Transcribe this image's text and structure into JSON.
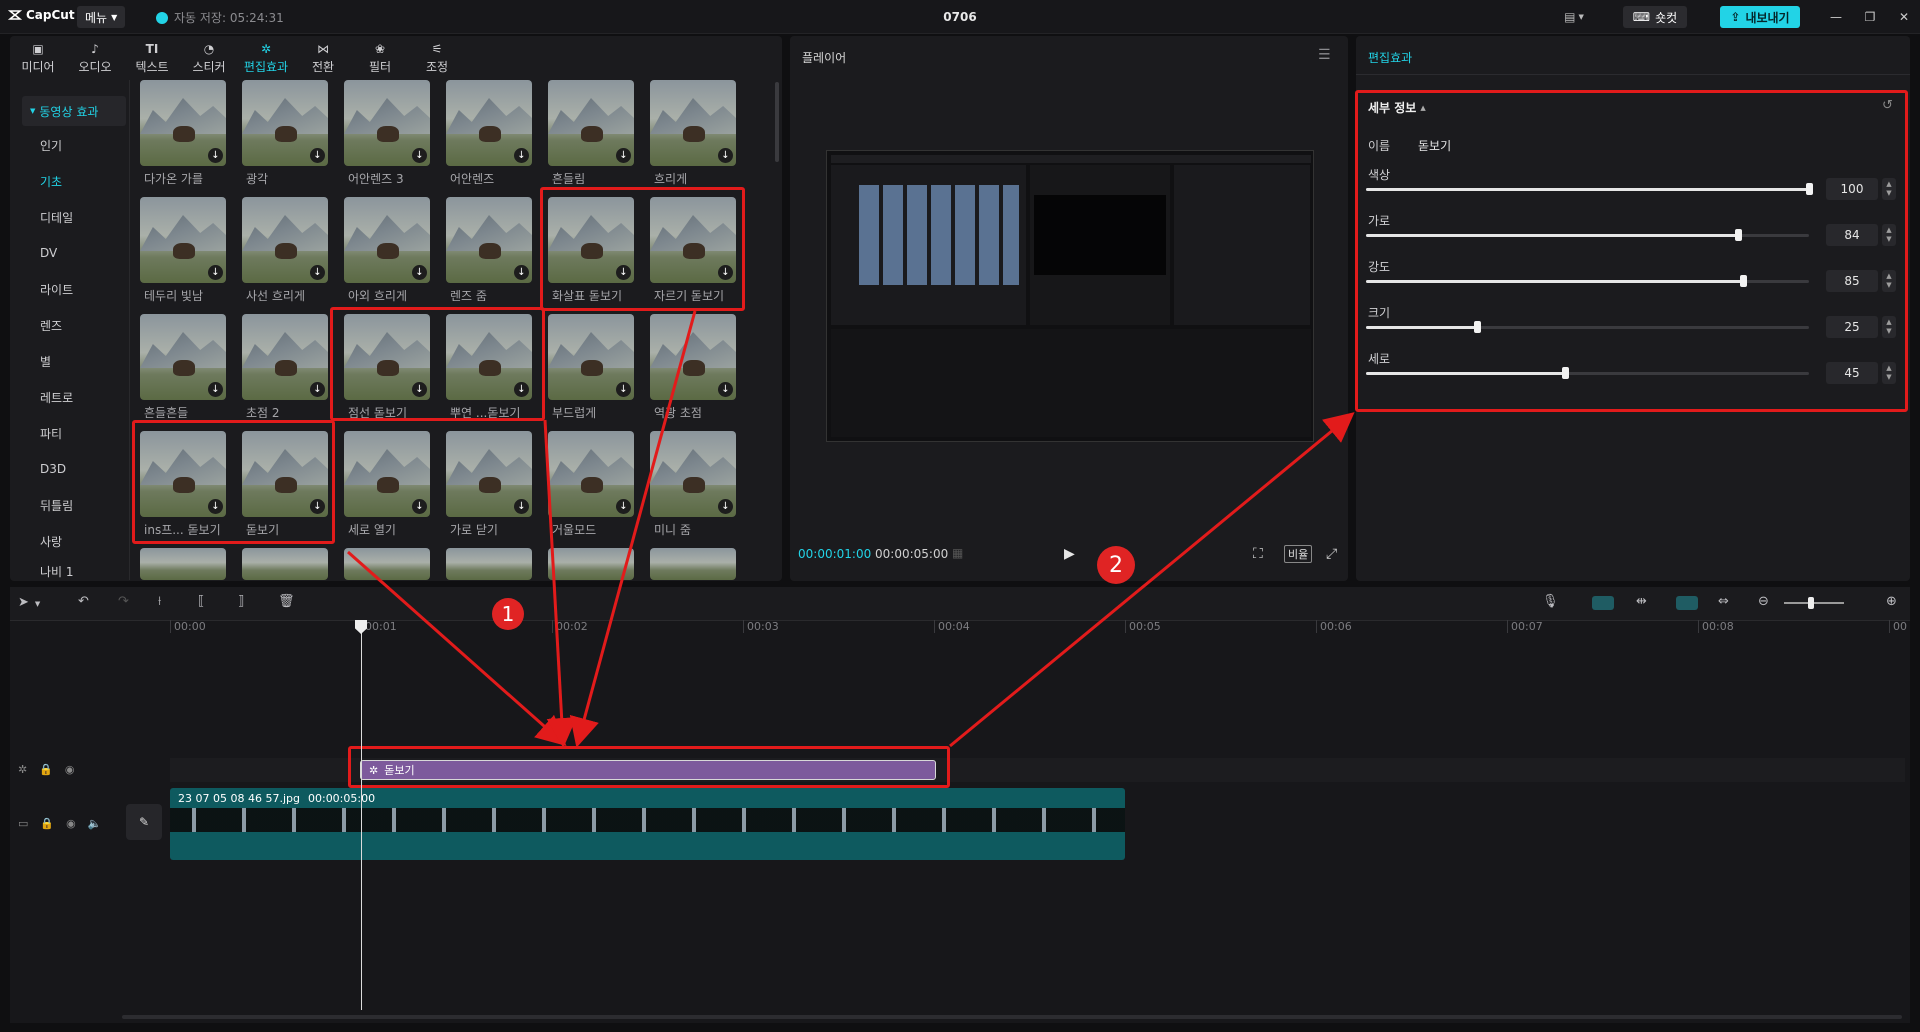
{
  "app": {
    "name": "CapCut",
    "menu_label": "메뉴",
    "autosave": "자동 저장: 05:24:31",
    "project_title": "0706",
    "shortcut_label": "숏컷",
    "export_label": "내보내기"
  },
  "toolbar": [
    {
      "label": "미디어",
      "icon": "media-icon"
    },
    {
      "label": "오디오",
      "icon": "audio-icon"
    },
    {
      "label": "텍스트",
      "icon": "text-icon"
    },
    {
      "label": "스티커",
      "icon": "sticker-icon"
    },
    {
      "label": "편집효과",
      "icon": "effects-icon",
      "active": true
    },
    {
      "label": "전환",
      "icon": "transition-icon"
    },
    {
      "label": "필터",
      "icon": "filter-icon"
    },
    {
      "label": "조정",
      "icon": "adjust-icon"
    }
  ],
  "categories": {
    "header": "동영상 효과",
    "items": [
      "인기",
      "기초",
      "디테일",
      "DV",
      "라이트",
      "렌즈",
      "별",
      "레트로",
      "파티",
      "D3D",
      "뒤틀림",
      "사랑",
      "나비 1"
    ],
    "active": "기초"
  },
  "effects": [
    {
      "label": "다가온 가를"
    },
    {
      "label": "광각"
    },
    {
      "label": "어안렌즈 3"
    },
    {
      "label": "어안렌즈"
    },
    {
      "label": "흔들림"
    },
    {
      "label": "흐리게"
    },
    {
      "label": "테두리 빛남"
    },
    {
      "label": "사선 흐리게"
    },
    {
      "label": "아외 흐리게"
    },
    {
      "label": "렌즈 줌"
    },
    {
      "label": "화살표 돋보기"
    },
    {
      "label": "자르기 돋보기"
    },
    {
      "label": "흔들흔들"
    },
    {
      "label": "초점 2"
    },
    {
      "label": "점선 돋보기"
    },
    {
      "label": "뿌연 ...돋보기"
    },
    {
      "label": "부드럽게"
    },
    {
      "label": "역광 초점"
    },
    {
      "label": "ins프... 돋보기"
    },
    {
      "label": "돋보기"
    },
    {
      "label": "세로 열기"
    },
    {
      "label": "가로 닫기"
    },
    {
      "label": "거울모드"
    },
    {
      "label": "미니 줌"
    }
  ],
  "player": {
    "title": "플레이어",
    "current_time": "00:00:01:00",
    "total_time": "00:00:05:00",
    "ratio_label": "비율"
  },
  "props": {
    "title": "편집효과",
    "section": "세부 정보",
    "name_label": "이름",
    "name_value": "돋보기",
    "params": [
      {
        "label": "색상",
        "value": 100
      },
      {
        "label": "가로",
        "value": 84
      },
      {
        "label": "강도",
        "value": 85
      },
      {
        "label": "크기",
        "value": 25
      },
      {
        "label": "세로",
        "value": 45
      }
    ]
  },
  "timeline": {
    "ruler": [
      "00:00",
      "00:01",
      "00:02",
      "00:03",
      "00:04",
      "00:05",
      "00:06",
      "00:07",
      "00:08",
      "00"
    ],
    "effect_clip": "돋보기",
    "video_clip": "23 07 05 08 46 57.jpg",
    "video_duration": "00:00:05:00"
  },
  "annotations": {
    "badge1": "1",
    "badge2": "2"
  },
  "colors": {
    "accent": "#22d3e6",
    "annotation": "#e21b1b",
    "effect_clip": "#7d5a9c",
    "video_track": "#0e5a5f"
  }
}
